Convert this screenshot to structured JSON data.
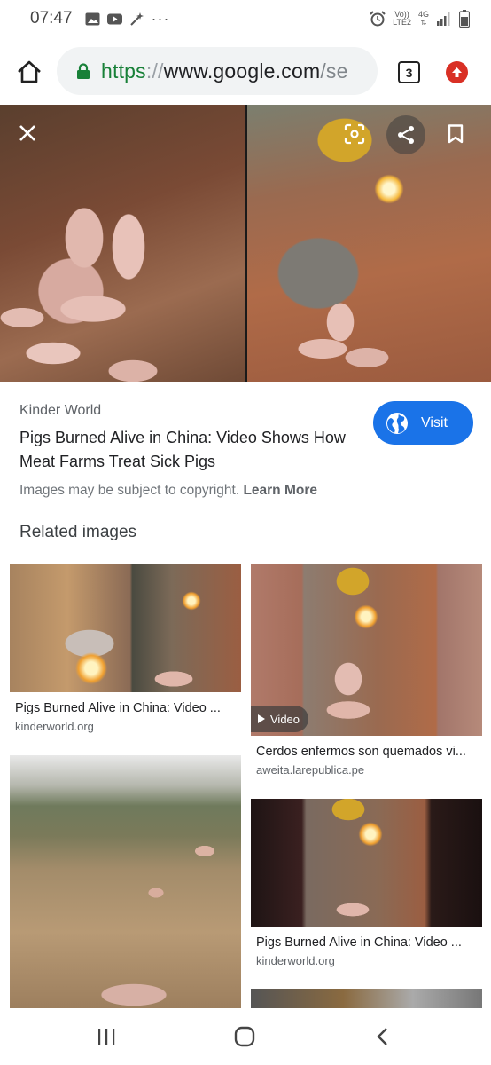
{
  "status_bar": {
    "time": "07:47",
    "volte": "Vo))",
    "lte": "LTE2",
    "network": "4G",
    "more_glyph": "···",
    "icons": [
      "gallery-icon",
      "youtube-icon",
      "magic-wand-icon",
      "more-dots-icon",
      "alarm-icon",
      "signal-icon",
      "battery-icon"
    ]
  },
  "browser": {
    "url_scheme": "https",
    "url_sep": "://",
    "url_host": "www.google.com",
    "url_path": "/se",
    "tab_count": "3",
    "icons": [
      "home-icon",
      "lock-icon",
      "update-icon"
    ]
  },
  "hero": {
    "icons": [
      "close-icon",
      "google-lens-icon",
      "share-icon",
      "bookmark-icon"
    ]
  },
  "result": {
    "source": "Kinder World",
    "title": "Pigs Burned Alive in China: Video Shows How Meat Farms Treat Sick Pigs",
    "visit_label": "Visit",
    "copyright_text": "Images may be subject to copyright.",
    "learn_more": "Learn More"
  },
  "related": {
    "heading": "Related images",
    "items": [
      {
        "title": "Pigs Burned Alive in China: Video ...",
        "domain": "kinderworld.org"
      },
      {
        "title": "Cerdos enfermos son quemados vi...",
        "domain": "aweita.larepublica.pe",
        "badge": "Video"
      },
      {
        "title": "",
        "domain": ""
      },
      {
        "title": "Pigs Burned Alive in China: Video ...",
        "domain": "kinderworld.org"
      }
    ]
  },
  "colors": {
    "accent": "#1a73e8",
    "url_green": "#188038",
    "update_red": "#d93025"
  }
}
